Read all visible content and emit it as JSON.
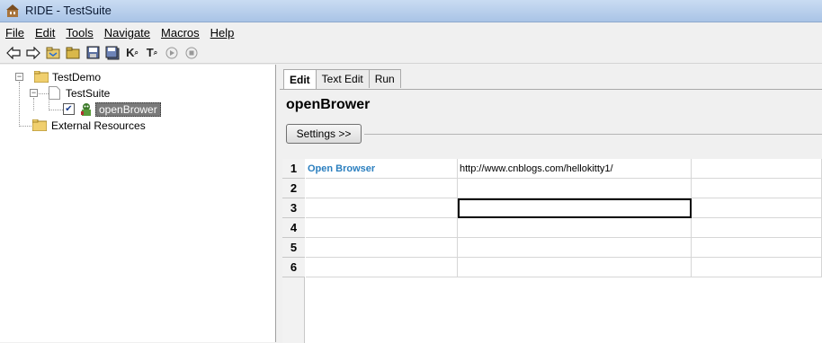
{
  "window": {
    "title": "RIDE - TestSuite"
  },
  "menu": [
    {
      "label": "File"
    },
    {
      "label": "Edit"
    },
    {
      "label": "Tools"
    },
    {
      "label": "Navigate"
    },
    {
      "label": "Macros"
    },
    {
      "label": "Help"
    }
  ],
  "toolbar": {
    "back": "back-arrow-icon",
    "forward": "forward-arrow-icon",
    "open_folder": "open-folder-icon",
    "open_dir": "open-directory-icon",
    "save": "save-icon",
    "save_all": "save-all-icon",
    "search_keywords": "K",
    "search_tests": "T",
    "run": "run-icon",
    "stop": "stop-icon"
  },
  "tree": {
    "root": "TestDemo",
    "suite": "TestSuite",
    "test_case": "openBrower",
    "test_checked": true,
    "external": "External Resources"
  },
  "tabs": [
    "Edit",
    "Text Edit",
    "Run"
  ],
  "active_tab": "Edit",
  "editor": {
    "keyword_name": "openBrower",
    "settings_label": "Settings >>"
  },
  "grid": {
    "rows": [
      {
        "num": "1",
        "cells": [
          "Open Browser",
          "http://www.cnblogs.com/hellokitty1/",
          ""
        ]
      },
      {
        "num": "2",
        "cells": [
          "",
          "",
          ""
        ]
      },
      {
        "num": "3",
        "cells": [
          "",
          "",
          ""
        ]
      },
      {
        "num": "4",
        "cells": [
          "",
          "",
          ""
        ]
      },
      {
        "num": "5",
        "cells": [
          "",
          "",
          ""
        ]
      },
      {
        "num": "6",
        "cells": [
          "",
          "",
          ""
        ]
      }
    ]
  },
  "colors": {
    "keyword": "#2b7fbf",
    "selection": "#7a7a7a",
    "titlebar": "#b9d1ea"
  }
}
